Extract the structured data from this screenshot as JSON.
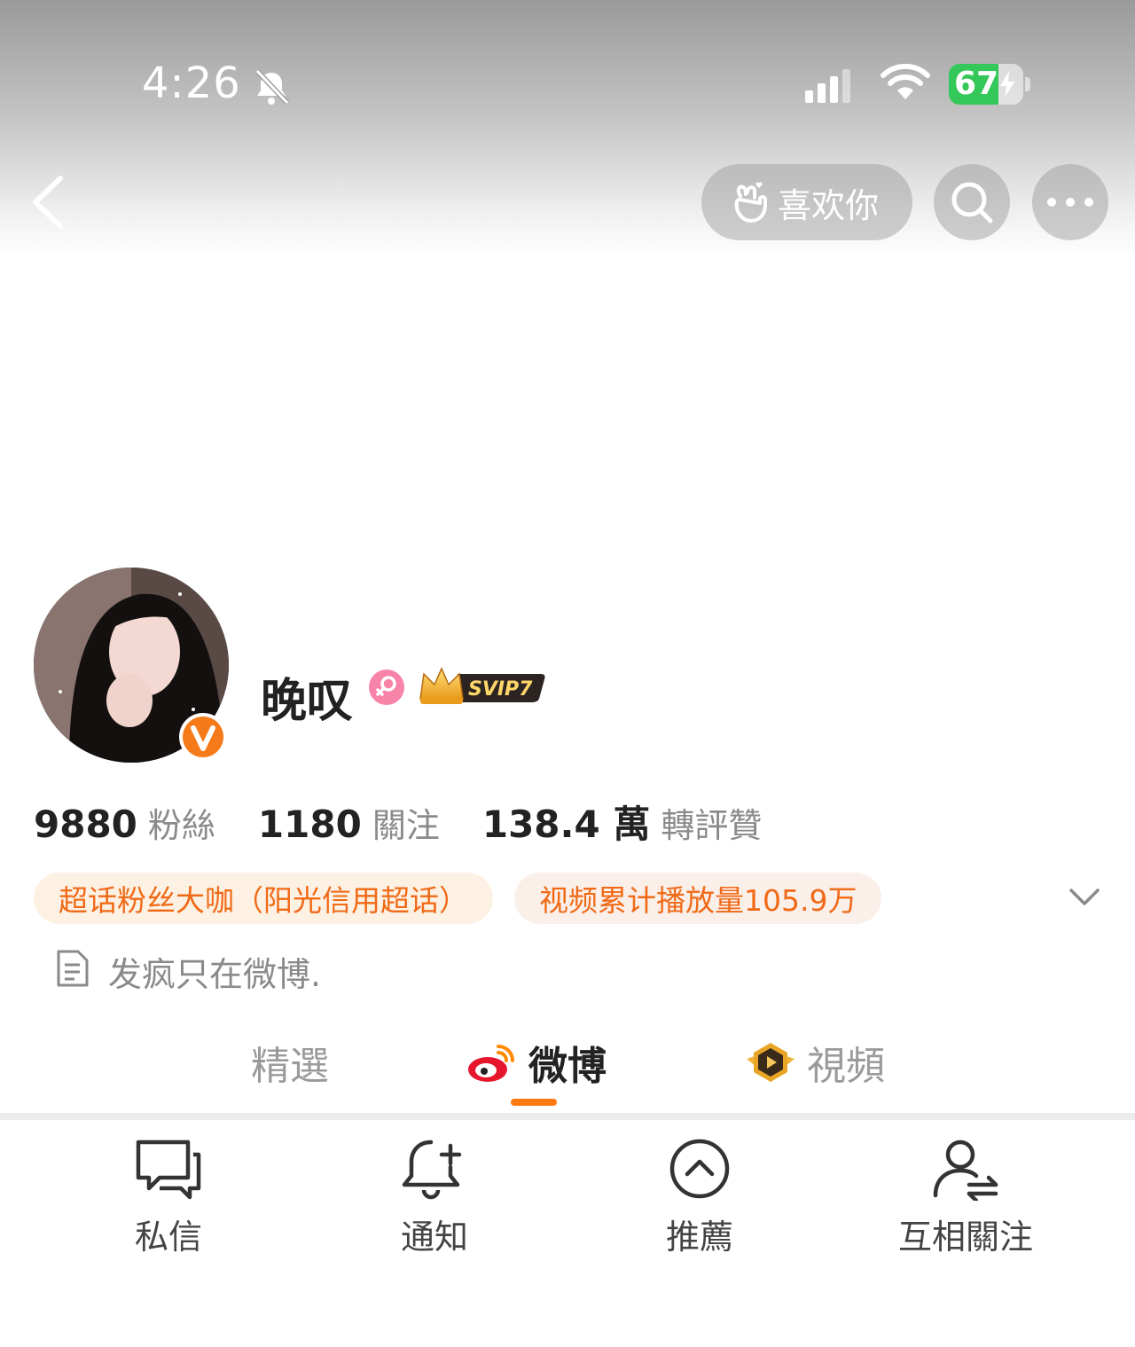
{
  "status_bar": {
    "time": "4:26",
    "battery_level": "67",
    "battery_fraction": 0.67,
    "icons": [
      "bell-slash-icon",
      "cellular-signal-icon",
      "wifi-icon",
      "battery-charging-icon"
    ]
  },
  "nav": {
    "back_icon": "chevron-left-icon",
    "like_label": "喜欢你",
    "like_icon": "finger-heart-icon",
    "search_icon": "search-icon",
    "more_icon": "more-horizontal-icon"
  },
  "profile": {
    "name": "晚叹",
    "gender_icon": "female-icon",
    "vip_badge": "SVIP7",
    "verified_icon": "verified-v-icon",
    "stats": [
      {
        "value": "9880",
        "label": "粉絲"
      },
      {
        "value": "1180",
        "label": "關注"
      },
      {
        "value": "138.4 萬",
        "label": "轉評贊"
      }
    ],
    "tags": [
      "超话粉丝大咖（阳光信用超话）",
      "视频累计播放量105.9万"
    ],
    "bio": "发疯只在微博."
  },
  "tabs": [
    {
      "label": "精選"
    },
    {
      "label": "微博",
      "active": true
    },
    {
      "label": "視頻"
    }
  ],
  "actions": [
    {
      "label": "私信",
      "icon": "message-icon"
    },
    {
      "label": "通知",
      "icon": "bell-plus-icon"
    },
    {
      "label": "推薦",
      "icon": "chevron-up-circle-icon"
    },
    {
      "label": "互相關注",
      "icon": "user-mutual-follow-icon"
    }
  ],
  "colors": {
    "accent": "#ff7a12",
    "tag_text": "#f06a16",
    "battery_green": "#34c759"
  }
}
